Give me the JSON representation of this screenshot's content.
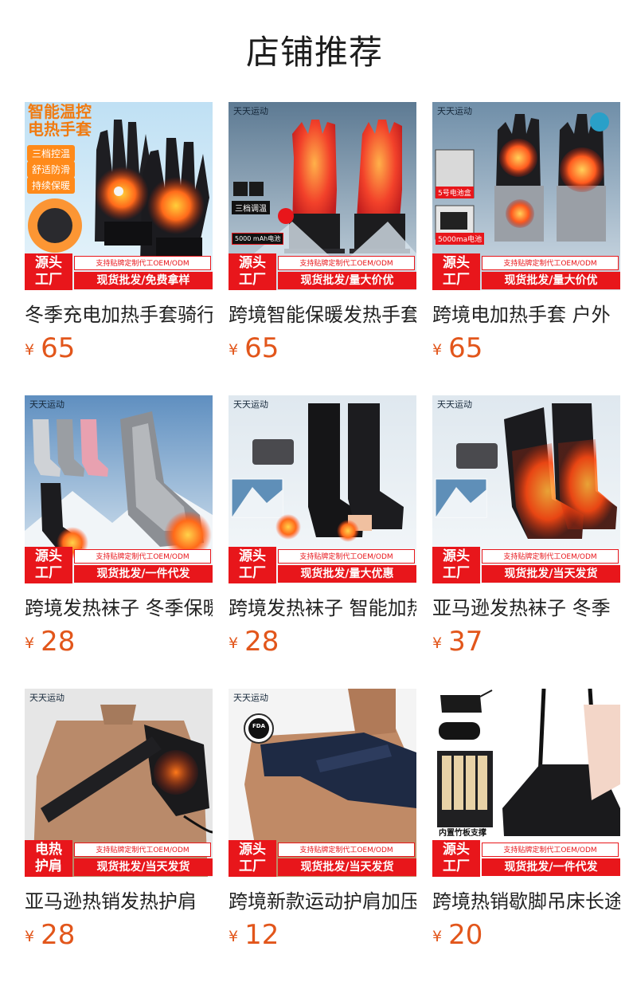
{
  "page_title": "店铺推荐",
  "currency_symbol": "¥",
  "products": [
    {
      "name": "冬季充电加热手套骑行",
      "price": "65",
      "badge_left": [
        "源头",
        "工厂"
      ],
      "badge_top": "支持贴牌定制代工OEM/ODM",
      "badge_bottom": "现货批发/免费拿样",
      "brand": "",
      "overlay": [
        "智能温控",
        "电热手套"
      ],
      "chips": [
        "三档控温",
        "舒适防滑",
        "持续保暖"
      ],
      "extras": []
    },
    {
      "name": "跨境智能保暖发热手套",
      "price": "65",
      "badge_left": [
        "源头",
        "工厂"
      ],
      "badge_top": "支持贴牌定制代工OEM/ODM",
      "badge_bottom": "现货批发/量大价优",
      "brand": "天天运动",
      "overlay": [],
      "chips": [
        "三档调温",
        "5000 mAh电池"
      ],
      "extras": []
    },
    {
      "name": "跨境电加热手套 户外",
      "price": "65",
      "badge_left": [
        "源头",
        "工厂"
      ],
      "badge_top": "支持贴牌定制代工OEM/ODM",
      "badge_bottom": "现货批发/量大价优",
      "brand": "天天运动",
      "overlay": [],
      "chips": [
        "5号电池盒",
        "5000ma电池"
      ],
      "extras": []
    },
    {
      "name": "跨境发热袜子 冬季保暖",
      "price": "28",
      "badge_left": [
        "源头",
        "工厂"
      ],
      "badge_top": "支持贴牌定制代工OEM/ODM",
      "badge_bottom": "现货批发/一件代发",
      "brand": "天天运动",
      "overlay": [],
      "chips": [],
      "extras": []
    },
    {
      "name": "跨境发热袜子 智能加热",
      "price": "28",
      "badge_left": [
        "源头",
        "工厂"
      ],
      "badge_top": "支持贴牌定制代工OEM/ODM",
      "badge_bottom": "现货批发/量大优惠",
      "brand": "天天运动",
      "overlay": [],
      "chips": [],
      "extras": []
    },
    {
      "name": "亚马逊发热袜子 冬季",
      "price": "37",
      "badge_left": [
        "源头",
        "工厂"
      ],
      "badge_top": "支持贴牌定制代工OEM/ODM",
      "badge_bottom": "现货批发/当天发货",
      "brand": "天天运动",
      "overlay": [],
      "chips": [],
      "extras": []
    },
    {
      "name": "亚马逊热销发热护肩",
      "price": "28",
      "badge_left": [
        "电热",
        "护肩"
      ],
      "badge_top": "支持贴牌定制代工OEM/ODM",
      "badge_bottom": "现货批发/当天发货",
      "brand": "天天运动",
      "overlay": [],
      "chips": [],
      "extras": []
    },
    {
      "name": "跨境新款运动护肩加压",
      "price": "12",
      "badge_left": [
        "源头",
        "工厂"
      ],
      "badge_top": "支持贴牌定制代工OEM/ODM",
      "badge_bottom": "现货批发/当天发货",
      "brand": "天天运动",
      "overlay": [],
      "chips": [],
      "extras": [
        "FDA"
      ]
    },
    {
      "name": "跨境热销歇脚吊床长途",
      "price": "20",
      "badge_left": [
        "源头",
        "工厂"
      ],
      "badge_top": "支持贴牌定制代工OEM/ODM",
      "badge_bottom": "现货批发/一件代发",
      "brand": "",
      "overlay": [],
      "chips": [],
      "extras": [
        "内置竹板支撑"
      ]
    }
  ]
}
